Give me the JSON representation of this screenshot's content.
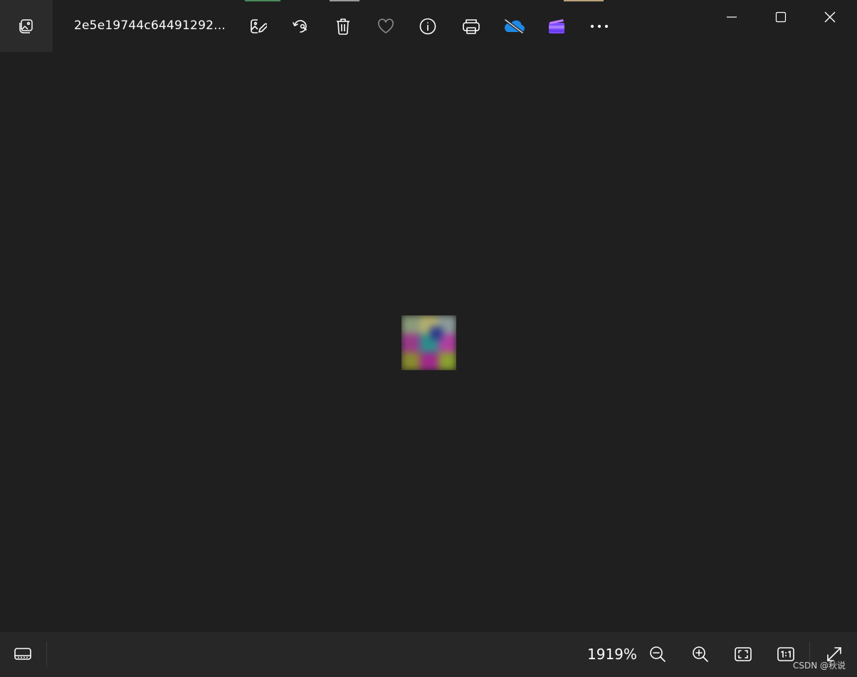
{
  "titlebar": {
    "filename": "2e5e19744c64491292..."
  },
  "toolbar": {
    "icons": [
      "edit-image-icon",
      "rotate-icon",
      "delete-icon",
      "favorite-icon",
      "info-icon",
      "print-icon",
      "onedrive-off-icon",
      "clipchamp-icon",
      "more-icon"
    ]
  },
  "window_controls": [
    "minimize-icon",
    "maximize-icon",
    "close-icon"
  ],
  "statusbar": {
    "zoom_level": "1919%"
  },
  "watermark": "CSDN @秋说",
  "colors": {
    "background": "#1f1f1f",
    "home_button_bg": "#2b2b2b",
    "bottombar_bg": "#272727",
    "onedrive_blue": "#1e88e5",
    "clipchamp_purple": "#8a5cf6"
  }
}
